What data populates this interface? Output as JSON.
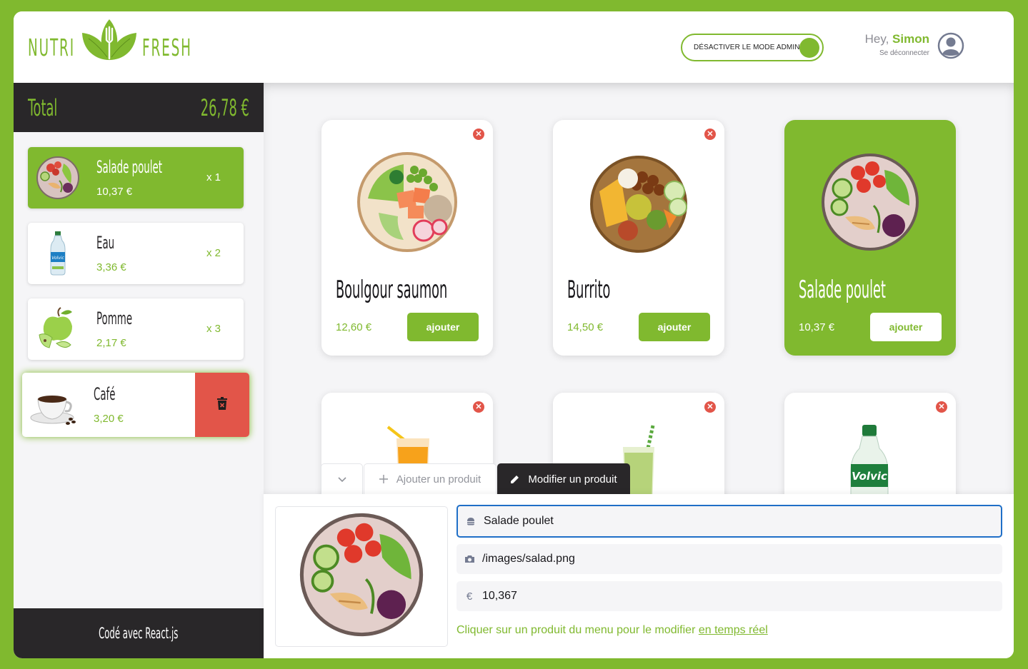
{
  "header": {
    "logo_left": "NUTRI",
    "logo_right": "FRESH",
    "admin_toggle_label": "DÉSACTIVER LE MODE ADMIN",
    "greeting_prefix": "Hey, ",
    "user_name": "Simon",
    "logout_label": "Se déconnecter"
  },
  "cart": {
    "total_label": "Total",
    "total_amount": "26,78 €",
    "items": [
      {
        "name": "Salade poulet",
        "price": "10,37 €",
        "qty": "x 1",
        "icon": "salad-image",
        "selected": true
      },
      {
        "name": "Eau",
        "price": "3,36 €",
        "qty": "x 2",
        "icon": "water-bottle-image"
      },
      {
        "name": "Pomme",
        "price": "2,17 €",
        "qty": "x 3",
        "icon": "apple-image"
      },
      {
        "name": "Café",
        "price": "3,20 €",
        "icon": "coffee-image",
        "hovered": true
      }
    ],
    "footer": "Codé avec React.js"
  },
  "menu": {
    "products": [
      {
        "title": "Boulgour saumon",
        "price": "12,60 €",
        "button": "ajouter",
        "icon": "salmon-bowl-image"
      },
      {
        "title": "Burrito",
        "price": "14,50 €",
        "button": "ajouter",
        "icon": "burrito-bowl-image"
      },
      {
        "title": "Salade poulet",
        "price": "10,37 €",
        "button": "ajouter",
        "icon": "salad-image",
        "selected": true
      },
      {
        "title": "",
        "icon": "orange-juice-image"
      },
      {
        "title": "",
        "icon": "smoothie-image"
      },
      {
        "title": "",
        "icon": "water-bottle-image"
      }
    ]
  },
  "admin": {
    "tabs": [
      {
        "label": "",
        "icon": "chevron-down-icon"
      },
      {
        "label": "Ajouter un produit",
        "icon": "plus-icon"
      },
      {
        "label": "Modifier un produit",
        "icon": "pencil-icon",
        "active": true
      }
    ],
    "form": {
      "name_value": "Salade poulet",
      "image_value": "/images/salad.png",
      "price_value": "10,367"
    },
    "hint_text": "Cliquer sur un produit du menu pour le modifier ",
    "hint_link": "en temps réel"
  },
  "colors": {
    "brand_green": "#80b92f",
    "dark": "#292729",
    "danger": "#e25549",
    "focus_blue": "#1f6fc7"
  }
}
